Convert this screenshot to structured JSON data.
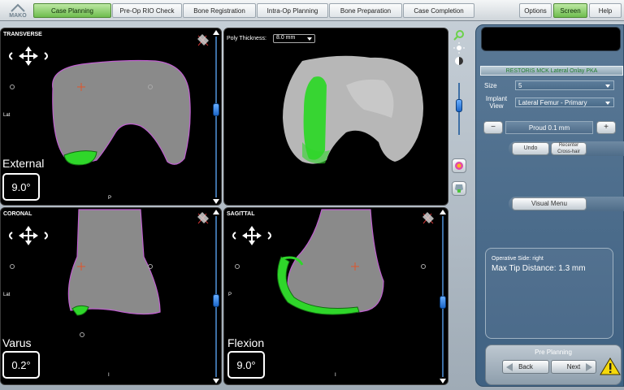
{
  "brand": {
    "logo_text": "MAKO"
  },
  "nav": {
    "tabs": [
      {
        "label": "Case Planning",
        "active": true
      },
      {
        "label": "Pre-Op RIO Check",
        "active": false
      },
      {
        "label": "Bone Registration",
        "active": false
      },
      {
        "label": "Intra-Op Planning",
        "active": false
      },
      {
        "label": "Bone Preparation",
        "active": false
      },
      {
        "label": "Case Completion",
        "active": false
      }
    ],
    "right": [
      {
        "label": "Options",
        "active": false
      },
      {
        "label": "Screen",
        "active": true
      },
      {
        "label": "Help",
        "active": false
      }
    ]
  },
  "views": {
    "transverse": {
      "title": "TRANSVERSE",
      "side_label": "Lat",
      "bottom_label": "P",
      "angle_name": "External",
      "angle_value": "9.0°"
    },
    "threed": {
      "poly_label": "Poly Thickness:",
      "poly_value": "8.0 mm"
    },
    "coronal": {
      "title": "CORONAL",
      "side_label": "Lat",
      "bottom_label": "I",
      "angle_name": "Varus",
      "angle_value": "0.2°"
    },
    "sagittal": {
      "title": "SAGITTAL",
      "side_label": "P",
      "bottom_label": "I",
      "angle_name": "Flexion",
      "angle_value": "9.0°"
    }
  },
  "panel": {
    "implant_title": "RESTORIS MCK Lateral Onlay PKA",
    "size_label": "Size",
    "size_value": "5",
    "implant_view_label": "Implant View",
    "implant_view_value": "Lateral Femur - Primary",
    "minus": "−",
    "plus": "+",
    "proud_value": "Proud 0.1 mm",
    "undo_label": "Undo",
    "recenter_label": "Recenter Cross-hair",
    "visual_menu_label": "Visual Menu",
    "operative_side": "Operative Side: right",
    "max_tip": "Max Tip Distance: 1.3 mm",
    "stage_label": "Pre Planning",
    "back_label": "Back",
    "next_label": "Next"
  },
  "colors": {
    "implant_green": "#2fd62a",
    "bone_outline": "#c060d0",
    "crosshair": "#e0542a",
    "active_tab": "#6fbd4e",
    "panel_bg": "#4a6b89"
  }
}
